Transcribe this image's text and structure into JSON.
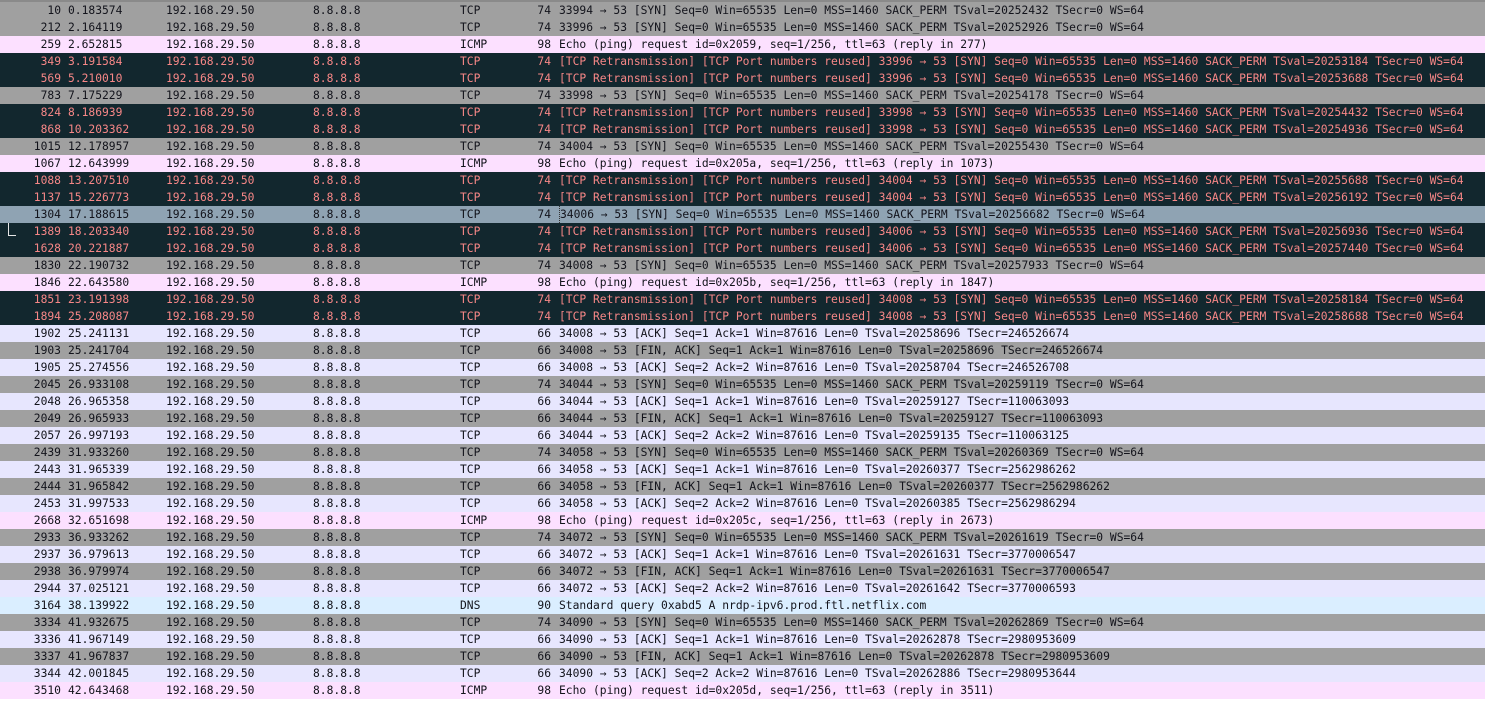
{
  "colors": {
    "tcp_gray": "#a0a0a0",
    "tcp_lavender": "#e7e6fe",
    "icmp_pink": "#fce0ff",
    "dns_blue": "#daeeff",
    "bad_tcp_bg": "#12272e",
    "bad_tcp_fg": "#f78787",
    "selected": "#8fa3b3"
  },
  "packets": [
    {
      "no": "10",
      "time": "0.183574",
      "src": "192.168.29.50",
      "dst": "8.8.8.8",
      "proto": "TCP",
      "len": "74",
      "info": "33994 → 53 [SYN] Seq=0 Win=65535 Len=0 MSS=1460 SACK_PERM TSval=20252432 TSecr=0 WS=64",
      "style": "tcp-a"
    },
    {
      "no": "212",
      "time": "2.164119",
      "src": "192.168.29.50",
      "dst": "8.8.8.8",
      "proto": "TCP",
      "len": "74",
      "info": "33996 → 53 [SYN] Seq=0 Win=65535 Len=0 MSS=1460 SACK_PERM TSval=20252926 TSecr=0 WS=64",
      "style": "tcp-a"
    },
    {
      "no": "259",
      "time": "2.652815",
      "src": "192.168.29.50",
      "dst": "8.8.8.8",
      "proto": "ICMP",
      "len": "98",
      "info": "Echo (ping) request  id=0x2059, seq=1/256, ttl=63 (reply in 277)",
      "style": "icmp"
    },
    {
      "no": "349",
      "time": "3.191584",
      "src": "192.168.29.50",
      "dst": "8.8.8.8",
      "proto": "TCP",
      "len": "74",
      "info": "[TCP Retransmission] [TCP Port numbers reused] 33996 → 53 [SYN] Seq=0 Win=65535 Len=0 MSS=1460 SACK_PERM TSval=20253184 TSecr=0 WS=64",
      "style": "bad"
    },
    {
      "no": "569",
      "time": "5.210010",
      "src": "192.168.29.50",
      "dst": "8.8.8.8",
      "proto": "TCP",
      "len": "74",
      "info": "[TCP Retransmission] [TCP Port numbers reused] 33996 → 53 [SYN] Seq=0 Win=65535 Len=0 MSS=1460 SACK_PERM TSval=20253688 TSecr=0 WS=64",
      "style": "bad"
    },
    {
      "no": "783",
      "time": "7.175229",
      "src": "192.168.29.50",
      "dst": "8.8.8.8",
      "proto": "TCP",
      "len": "74",
      "info": "33998 → 53 [SYN] Seq=0 Win=65535 Len=0 MSS=1460 SACK_PERM TSval=20254178 TSecr=0 WS=64",
      "style": "tcp-a"
    },
    {
      "no": "824",
      "time": "8.186939",
      "src": "192.168.29.50",
      "dst": "8.8.8.8",
      "proto": "TCP",
      "len": "74",
      "info": "[TCP Retransmission] [TCP Port numbers reused] 33998 → 53 [SYN] Seq=0 Win=65535 Len=0 MSS=1460 SACK_PERM TSval=20254432 TSecr=0 WS=64",
      "style": "bad"
    },
    {
      "no": "868",
      "time": "10.203362",
      "src": "192.168.29.50",
      "dst": "8.8.8.8",
      "proto": "TCP",
      "len": "74",
      "info": "[TCP Retransmission] [TCP Port numbers reused] 33998 → 53 [SYN] Seq=0 Win=65535 Len=0 MSS=1460 SACK_PERM TSval=20254936 TSecr=0 WS=64",
      "style": "bad"
    },
    {
      "no": "1015",
      "time": "12.178957",
      "src": "192.168.29.50",
      "dst": "8.8.8.8",
      "proto": "TCP",
      "len": "74",
      "info": "34004 → 53 [SYN] Seq=0 Win=65535 Len=0 MSS=1460 SACK_PERM TSval=20255430 TSecr=0 WS=64",
      "style": "tcp-a"
    },
    {
      "no": "1067",
      "time": "12.643999",
      "src": "192.168.29.50",
      "dst": "8.8.8.8",
      "proto": "ICMP",
      "len": "98",
      "info": "Echo (ping) request  id=0x205a, seq=1/256, ttl=63 (reply in 1073)",
      "style": "icmp"
    },
    {
      "no": "1088",
      "time": "13.207510",
      "src": "192.168.29.50",
      "dst": "8.8.8.8",
      "proto": "TCP",
      "len": "74",
      "info": "[TCP Retransmission] [TCP Port numbers reused] 34004 → 53 [SYN] Seq=0 Win=65535 Len=0 MSS=1460 SACK_PERM TSval=20255688 TSecr=0 WS=64",
      "style": "bad"
    },
    {
      "no": "1137",
      "time": "15.226773",
      "src": "192.168.29.50",
      "dst": "8.8.8.8",
      "proto": "TCP",
      "len": "74",
      "info": "[TCP Retransmission] [TCP Port numbers reused] 34004 → 53 [SYN] Seq=0 Win=65535 Len=0 MSS=1460 SACK_PERM TSval=20256192 TSecr=0 WS=64",
      "style": "bad"
    },
    {
      "no": "1304",
      "time": "17.188615",
      "src": "192.168.29.50",
      "dst": "8.8.8.8",
      "proto": "TCP",
      "len": "74",
      "info": "34006 → 53 [SYN] Seq=0 Win=65535 Len=0 MSS=1460 SACK_PERM TSval=20256682 TSecr=0 WS=64",
      "style": "selected"
    },
    {
      "no": "1389",
      "time": "18.203340",
      "src": "192.168.29.50",
      "dst": "8.8.8.8",
      "proto": "TCP",
      "len": "74",
      "info": "[TCP Retransmission] [TCP Port numbers reused] 34006 → 53 [SYN] Seq=0 Win=65535 Len=0 MSS=1460 SACK_PERM TSval=20256936 TSecr=0 WS=64",
      "style": "bad",
      "related": "mid"
    },
    {
      "no": "1628",
      "time": "20.221887",
      "src": "192.168.29.50",
      "dst": "8.8.8.8",
      "proto": "TCP",
      "len": "74",
      "info": "[TCP Retransmission] [TCP Port numbers reused] 34006 → 53 [SYN] Seq=0 Win=65535 Len=0 MSS=1460 SACK_PERM TSval=20257440 TSecr=0 WS=64",
      "style": "bad"
    },
    {
      "no": "1830",
      "time": "22.190732",
      "src": "192.168.29.50",
      "dst": "8.8.8.8",
      "proto": "TCP",
      "len": "74",
      "info": "34008 → 53 [SYN] Seq=0 Win=65535 Len=0 MSS=1460 SACK_PERM TSval=20257933 TSecr=0 WS=64",
      "style": "tcp-a"
    },
    {
      "no": "1846",
      "time": "22.643580",
      "src": "192.168.29.50",
      "dst": "8.8.8.8",
      "proto": "ICMP",
      "len": "98",
      "info": "Echo (ping) request  id=0x205b, seq=1/256, ttl=63 (reply in 1847)",
      "style": "icmp"
    },
    {
      "no": "1851",
      "time": "23.191398",
      "src": "192.168.29.50",
      "dst": "8.8.8.8",
      "proto": "TCP",
      "len": "74",
      "info": "[TCP Retransmission] [TCP Port numbers reused] 34008 → 53 [SYN] Seq=0 Win=65535 Len=0 MSS=1460 SACK_PERM TSval=20258184 TSecr=0 WS=64",
      "style": "bad"
    },
    {
      "no": "1894",
      "time": "25.208087",
      "src": "192.168.29.50",
      "dst": "8.8.8.8",
      "proto": "TCP",
      "len": "74",
      "info": "[TCP Retransmission] [TCP Port numbers reused] 34008 → 53 [SYN] Seq=0 Win=65535 Len=0 MSS=1460 SACK_PERM TSval=20258688 TSecr=0 WS=64",
      "style": "bad"
    },
    {
      "no": "1902",
      "time": "25.241131",
      "src": "192.168.29.50",
      "dst": "8.8.8.8",
      "proto": "TCP",
      "len": "66",
      "info": "34008 → 53 [ACK] Seq=1 Ack=1 Win=87616 Len=0 TSval=20258696 TSecr=246526674",
      "style": "tcp-b"
    },
    {
      "no": "1903",
      "time": "25.241704",
      "src": "192.168.29.50",
      "dst": "8.8.8.8",
      "proto": "TCP",
      "len": "66",
      "info": "34008 → 53 [FIN, ACK] Seq=1 Ack=1 Win=87616 Len=0 TSval=20258696 TSecr=246526674",
      "style": "tcp-a"
    },
    {
      "no": "1905",
      "time": "25.274556",
      "src": "192.168.29.50",
      "dst": "8.8.8.8",
      "proto": "TCP",
      "len": "66",
      "info": "34008 → 53 [ACK] Seq=2 Ack=2 Win=87616 Len=0 TSval=20258704 TSecr=246526708",
      "style": "tcp-b"
    },
    {
      "no": "2045",
      "time": "26.933108",
      "src": "192.168.29.50",
      "dst": "8.8.8.8",
      "proto": "TCP",
      "len": "74",
      "info": "34044 → 53 [SYN] Seq=0 Win=65535 Len=0 MSS=1460 SACK_PERM TSval=20259119 TSecr=0 WS=64",
      "style": "tcp-a"
    },
    {
      "no": "2048",
      "time": "26.965358",
      "src": "192.168.29.50",
      "dst": "8.8.8.8",
      "proto": "TCP",
      "len": "66",
      "info": "34044 → 53 [ACK] Seq=1 Ack=1 Win=87616 Len=0 TSval=20259127 TSecr=110063093",
      "style": "tcp-b"
    },
    {
      "no": "2049",
      "time": "26.965933",
      "src": "192.168.29.50",
      "dst": "8.8.8.8",
      "proto": "TCP",
      "len": "66",
      "info": "34044 → 53 [FIN, ACK] Seq=1 Ack=1 Win=87616 Len=0 TSval=20259127 TSecr=110063093",
      "style": "tcp-a"
    },
    {
      "no": "2057",
      "time": "26.997193",
      "src": "192.168.29.50",
      "dst": "8.8.8.8",
      "proto": "TCP",
      "len": "66",
      "info": "34044 → 53 [ACK] Seq=2 Ack=2 Win=87616 Len=0 TSval=20259135 TSecr=110063125",
      "style": "tcp-b"
    },
    {
      "no": "2439",
      "time": "31.933260",
      "src": "192.168.29.50",
      "dst": "8.8.8.8",
      "proto": "TCP",
      "len": "74",
      "info": "34058 → 53 [SYN] Seq=0 Win=65535 Len=0 MSS=1460 SACK_PERM TSval=20260369 TSecr=0 WS=64",
      "style": "tcp-a"
    },
    {
      "no": "2443",
      "time": "31.965339",
      "src": "192.168.29.50",
      "dst": "8.8.8.8",
      "proto": "TCP",
      "len": "66",
      "info": "34058 → 53 [ACK] Seq=1 Ack=1 Win=87616 Len=0 TSval=20260377 TSecr=2562986262",
      "style": "tcp-b"
    },
    {
      "no": "2444",
      "time": "31.965842",
      "src": "192.168.29.50",
      "dst": "8.8.8.8",
      "proto": "TCP",
      "len": "66",
      "info": "34058 → 53 [FIN, ACK] Seq=1 Ack=1 Win=87616 Len=0 TSval=20260377 TSecr=2562986262",
      "style": "tcp-a"
    },
    {
      "no": "2453",
      "time": "31.997533",
      "src": "192.168.29.50",
      "dst": "8.8.8.8",
      "proto": "TCP",
      "len": "66",
      "info": "34058 → 53 [ACK] Seq=2 Ack=2 Win=87616 Len=0 TSval=20260385 TSecr=2562986294",
      "style": "tcp-b"
    },
    {
      "no": "2668",
      "time": "32.651698",
      "src": "192.168.29.50",
      "dst": "8.8.8.8",
      "proto": "ICMP",
      "len": "98",
      "info": "Echo (ping) request  id=0x205c, seq=1/256, ttl=63 (reply in 2673)",
      "style": "icmp"
    },
    {
      "no": "2933",
      "time": "36.933262",
      "src": "192.168.29.50",
      "dst": "8.8.8.8",
      "proto": "TCP",
      "len": "74",
      "info": "34072 → 53 [SYN] Seq=0 Win=65535 Len=0 MSS=1460 SACK_PERM TSval=20261619 TSecr=0 WS=64",
      "style": "tcp-a"
    },
    {
      "no": "2937",
      "time": "36.979613",
      "src": "192.168.29.50",
      "dst": "8.8.8.8",
      "proto": "TCP",
      "len": "66",
      "info": "34072 → 53 [ACK] Seq=1 Ack=1 Win=87616 Len=0 TSval=20261631 TSecr=3770006547",
      "style": "tcp-b"
    },
    {
      "no": "2938",
      "time": "36.979974",
      "src": "192.168.29.50",
      "dst": "8.8.8.8",
      "proto": "TCP",
      "len": "66",
      "info": "34072 → 53 [FIN, ACK] Seq=1 Ack=1 Win=87616 Len=0 TSval=20261631 TSecr=3770006547",
      "style": "tcp-a"
    },
    {
      "no": "2944",
      "time": "37.025121",
      "src": "192.168.29.50",
      "dst": "8.8.8.8",
      "proto": "TCP",
      "len": "66",
      "info": "34072 → 53 [ACK] Seq=2 Ack=2 Win=87616 Len=0 TSval=20261642 TSecr=3770006593",
      "style": "tcp-b"
    },
    {
      "no": "3164",
      "time": "38.139922",
      "src": "192.168.29.50",
      "dst": "8.8.8.8",
      "proto": "DNS",
      "len": "90",
      "info": "Standard query 0xabd5 A nrdp-ipv6.prod.ftl.netflix.com",
      "style": "dns"
    },
    {
      "no": "3334",
      "time": "41.932675",
      "src": "192.168.29.50",
      "dst": "8.8.8.8",
      "proto": "TCP",
      "len": "74",
      "info": "34090 → 53 [SYN] Seq=0 Win=65535 Len=0 MSS=1460 SACK_PERM TSval=20262869 TSecr=0 WS=64",
      "style": "tcp-a"
    },
    {
      "no": "3336",
      "time": "41.967149",
      "src": "192.168.29.50",
      "dst": "8.8.8.8",
      "proto": "TCP",
      "len": "66",
      "info": "34090 → 53 [ACK] Seq=1 Ack=1 Win=87616 Len=0 TSval=20262878 TSecr=2980953609",
      "style": "tcp-b"
    },
    {
      "no": "3337",
      "time": "41.967837",
      "src": "192.168.29.50",
      "dst": "8.8.8.8",
      "proto": "TCP",
      "len": "66",
      "info": "34090 → 53 [FIN, ACK] Seq=1 Ack=1 Win=87616 Len=0 TSval=20262878 TSecr=2980953609",
      "style": "tcp-a"
    },
    {
      "no": "3344",
      "time": "42.001845",
      "src": "192.168.29.50",
      "dst": "8.8.8.8",
      "proto": "TCP",
      "len": "66",
      "info": "34090 → 53 [ACK] Seq=2 Ack=2 Win=87616 Len=0 TSval=20262886 TSecr=2980953644",
      "style": "tcp-b"
    },
    {
      "no": "3510",
      "time": "42.643468",
      "src": "192.168.29.50",
      "dst": "8.8.8.8",
      "proto": "ICMP",
      "len": "98",
      "info": "Echo (ping) request  id=0x205d, seq=1/256, ttl=63 (reply in 3511)",
      "style": "icmp"
    }
  ]
}
